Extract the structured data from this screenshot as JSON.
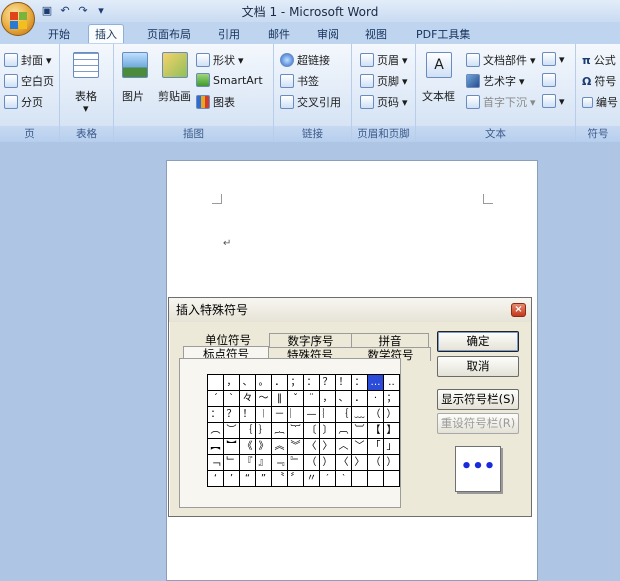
{
  "window": {
    "title": "文档 1 - Microsoft Word"
  },
  "tabs": [
    "开始",
    "插入",
    "页面布局",
    "引用",
    "邮件",
    "审阅",
    "视图",
    "PDF工具集"
  ],
  "active_tab": "插入",
  "ribbon": {
    "pages": {
      "label": "页",
      "items": [
        "封面",
        "空白页",
        "分页"
      ]
    },
    "table": {
      "label": "表格",
      "item": "表格"
    },
    "illustrations": {
      "label": "插图",
      "picture": "图片",
      "clipart": "剪贴画",
      "shapes": "形状",
      "smartart": "SmartArt",
      "chart": "图表"
    },
    "links": {
      "label": "链接",
      "hyperlink": "超链接",
      "bookmark": "书签",
      "crossref": "交叉引用"
    },
    "header_footer": {
      "label": "页眉和页脚",
      "header": "页眉",
      "footer": "页脚",
      "page_number": "页码"
    },
    "text": {
      "label": "文本",
      "textbox": "文本框",
      "quickparts": "文档部件",
      "wordart": "艺术字",
      "dropcap": "首字下沉"
    },
    "symbols": {
      "label": "符号",
      "equation": "公式",
      "symbol": "符号",
      "numbering": "编号"
    }
  },
  "document": {
    "paragraph_mark": "↵"
  },
  "dialog": {
    "title": "插入特殊符号",
    "close": "×",
    "tabs_row1": [
      "单位符号",
      "数字序号",
      "拼音"
    ],
    "tabs_row2": [
      "标点符号",
      "特殊符号",
      "数学符号"
    ],
    "selected_tab": "标点符号",
    "symbols": [
      [
        "",
        "，",
        "、",
        "。",
        "．",
        "；",
        "：",
        "？",
        "！",
        "：",
        "…",
        "‥"
      ],
      [
        "´",
        "ˋ",
        "々",
        "～",
        "‖",
        "ˇ",
        "¨",
        "，",
        "、",
        "．",
        "·",
        "；"
      ],
      [
        "：",
        "？",
        "！",
        "︱",
        "－",
        "︳",
        "—",
        "︴",
        "｛",
        "﹏",
        "（",
        "）"
      ],
      [
        "︵",
        "︶",
        "｛",
        "｝",
        "︷",
        "︸",
        "〔",
        "〕",
        "︹",
        "︺",
        "【",
        "】"
      ],
      [
        "︻",
        "︼",
        "《",
        "》",
        "︽",
        "︾",
        "〈",
        "〉",
        "︿",
        "﹀",
        "「",
        "」"
      ],
      [
        "﹁",
        "﹂",
        "『",
        "』",
        "﹃",
        "﹄",
        "（",
        "）",
        "〈",
        "〉",
        "（",
        "）"
      ],
      [
        "‘",
        "’",
        "“",
        "”",
        "〝",
        "〞",
        "〃",
        "′",
        "‵",
        "",
        "",
        ""
      ]
    ],
    "highlighted_index": 10,
    "buttons": {
      "ok": "确定",
      "cancel": "取消",
      "show_bar": "显示符号栏(S)",
      "reset_bar": "重设符号栏(R)"
    },
    "preview": "•••"
  }
}
